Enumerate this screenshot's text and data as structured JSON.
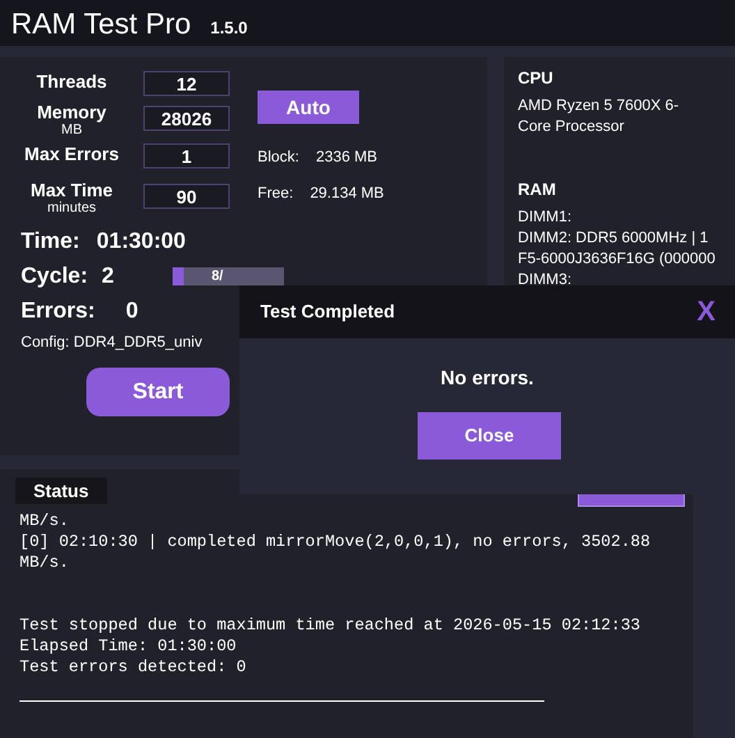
{
  "window": {
    "title": "RAM Test Pro",
    "version": "1.5.0"
  },
  "settings": [
    {
      "label": "Threads",
      "value": "12"
    },
    {
      "label": "Memory",
      "sublabel": "MB",
      "value": "28026"
    },
    {
      "label": "Max Errors",
      "value": "1"
    },
    {
      "label": "Max Time",
      "sublabel": "minutes",
      "value": "90"
    }
  ],
  "auto_button": "Auto",
  "memory_info": [
    {
      "label": "Block:",
      "value": "2336 MB"
    },
    {
      "label": "Free:",
      "value": "29.134 MB"
    }
  ],
  "stats": {
    "time_label": "Time:",
    "time": "01:30:00",
    "cycle_label": "Cycle:",
    "cycle": "2",
    "progress": {
      "level": 0.1,
      "text": "8/"
    },
    "errors_label": "Errors:",
    "errors": "0",
    "config": "Config: DDR4_DDR5_univ"
  },
  "start_button": "Start",
  "system": {
    "cpu_heading": "CPU",
    "cpu": "AMD Ryzen 5 7600X 6-Core Processor",
    "ram_heading": "RAM",
    "ram_lines": [
      "DIMM1:",
      "DIMM2: DDR5 6000MHz | 1",
      "F5-6000J3636F16G (000000",
      "DIMM3:"
    ]
  },
  "log": {
    "tab": "Status",
    "lines": [
      "MB/s.",
      "[0] 02:10:30 | completed mirrorMove(2,0,0,1), no errors, 3502.88 MB/s."
    ],
    "summary": [
      "Test stopped due to maximum time reached at 2026-05-15 02:12:33",
      "Elapsed Time: 01:30:00",
      "Test errors detected: 0"
    ]
  },
  "dialog": {
    "title": "Test Completed",
    "close_glyph": "X",
    "message": "No errors.",
    "button": "Close"
  }
}
